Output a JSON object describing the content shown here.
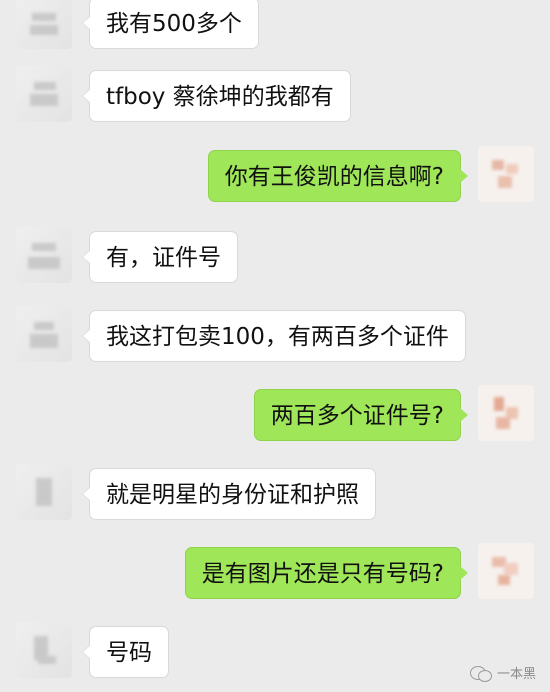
{
  "messages": [
    {
      "side": "incoming",
      "text": "我有500多个",
      "avatar_icon": "contact-avatar"
    },
    {
      "side": "incoming",
      "text": "tfboy 蔡徐坤的我都有",
      "avatar_icon": "contact-avatar"
    },
    {
      "side": "outgoing",
      "text": "你有王俊凯的信息啊?",
      "avatar_icon": "self-avatar"
    },
    {
      "side": "incoming",
      "text": "有，证件号",
      "avatar_icon": "contact-avatar"
    },
    {
      "side": "incoming",
      "text": "我这打包卖100，有两百多个证件",
      "avatar_icon": "contact-avatar"
    },
    {
      "side": "outgoing",
      "text": "两百多个证件号?",
      "avatar_icon": "self-avatar"
    },
    {
      "side": "incoming",
      "text": "就是明星的身份证和护照",
      "avatar_icon": "contact-avatar"
    },
    {
      "side": "outgoing",
      "text": "是有图片还是只有号码?",
      "avatar_icon": "self-avatar"
    },
    {
      "side": "incoming",
      "text": "号码",
      "avatar_icon": "contact-avatar"
    }
  ],
  "watermark": {
    "label": "一本黑",
    "icon": "wechat-icon"
  },
  "colors": {
    "background": "#ebebeb",
    "incoming_bubble": "#ffffff",
    "outgoing_bubble": "#9fe658"
  }
}
